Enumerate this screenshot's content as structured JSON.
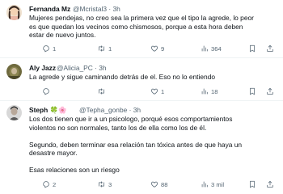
{
  "tweets": [
    {
      "name": "Fernanda Mz",
      "handle": "@Mcristal3",
      "sep": "·",
      "time": "3h",
      "text_lines": [
        "Mujeres pendejas, no creo sea la primera vez que el tipo la agrede, lo peor",
        "es que quedan los vecinos como chismosos, porque a esta hora deben",
        "estar de nuevo juntos."
      ],
      "replies": "1",
      "retweets": "1",
      "likes": "9",
      "views": "364"
    },
    {
      "name": "Aly Jazz",
      "handle": "@Alicia_PC",
      "sep": "·",
      "time": "3h",
      "text_lines": [
        "La agrede y sigue caminando detrás de el. Eso no lo entiendo"
      ],
      "replies": "",
      "retweets": "",
      "likes": "1",
      "views": "18"
    },
    {
      "name": "Steph",
      "name_emojis": "🍀🌸",
      "handle": "@Tepha_gonbe",
      "sep": "·",
      "time": "3h",
      "text_lines": [
        "Los dos tienen que ir a un psicologo, porqué esos comportamientos",
        "violentos no son normales, tanto los de ella como los de él."
      ],
      "text_lines_2": [
        "Segundo, deben terminar esa relación tan tóxica antes de que haya un",
        "desastre mayor."
      ],
      "text_lines_3": [
        "Esas relaciones son un riesgo"
      ],
      "replies": "2",
      "retweets": "3",
      "likes": "88",
      "views": "3 mil"
    }
  ],
  "icons": [
    "reply-icon",
    "retweet-icon",
    "like-icon",
    "views-icon",
    "bookmark-icon",
    "share-icon"
  ],
  "colors": {
    "text": "#0f1419",
    "secondary": "#536471",
    "divider": "#eff3f4"
  }
}
